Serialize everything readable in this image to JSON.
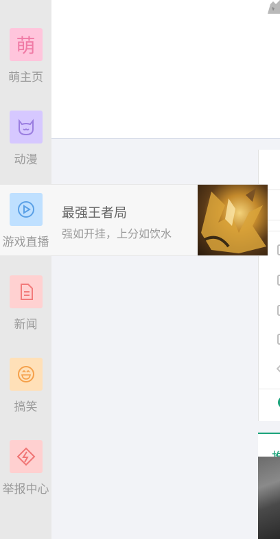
{
  "sidebar": {
    "items": [
      {
        "label": "萌主页",
        "icon": "meng-icon",
        "color": "#ffc5dc",
        "fg": "#f07aa5",
        "glyph": "萌"
      },
      {
        "label": "动漫",
        "icon": "cat-face-icon",
        "color": "#d6c8ff",
        "fg": "#9a7de0"
      },
      {
        "label": "游戏直播",
        "icon": "play-icon",
        "color": "#bfe0ff",
        "fg": "#5aa0e6"
      },
      {
        "label": "新闻",
        "icon": "document-icon",
        "color": "#ffd1d1",
        "fg": "#f27a7a"
      },
      {
        "label": "搞笑",
        "icon": "laugh-icon",
        "color": "#ffe0b8",
        "fg": "#f5a04a"
      },
      {
        "label": "举报中心",
        "icon": "report-icon",
        "color": "#ffd0d0",
        "fg": "#f07575"
      }
    ]
  },
  "live_popup": {
    "title": "最强王者局",
    "subtitle": "强如开挂，上分如饮水"
  },
  "right_tab": {
    "label": "推"
  },
  "colors": {
    "accent": "#1aa37a",
    "sidebar_bg": "#e8e8e8",
    "page_bg": "#f2f3f7"
  }
}
